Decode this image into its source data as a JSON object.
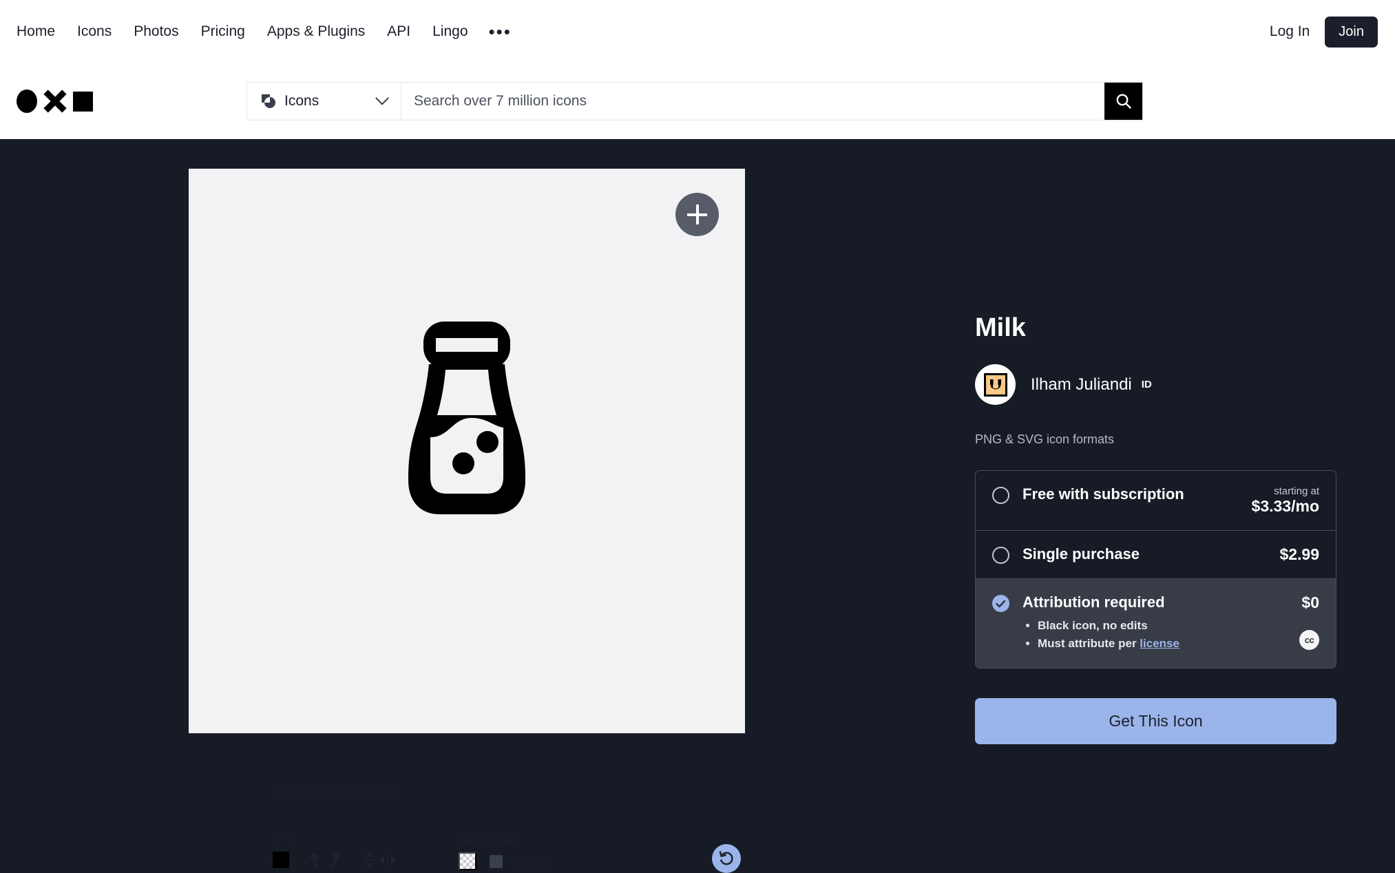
{
  "nav": {
    "links": [
      "Home",
      "Icons",
      "Photos",
      "Pricing",
      "Apps & Plugins",
      "API",
      "Lingo"
    ],
    "more": "•••",
    "login": "Log In",
    "join": "Join"
  },
  "search": {
    "type_label": "Icons",
    "placeholder": "Search over 7 million icons",
    "value": "",
    "search_icon": "search-icon"
  },
  "preview": {
    "add_icon": "plus-icon",
    "icon_name": "milk-bottle-icon",
    "customize_title": "Customize this icon",
    "icon_group_label": "Icon",
    "background_group_label": "Background",
    "background_square_label": "Square",
    "icon_color": "#000000",
    "background_square_color": "#3a3f4d",
    "tools": [
      "rotate-left-icon",
      "rotate-right-icon",
      "flip-vertical-icon",
      "flip-horizontal-icon"
    ],
    "reset_label": "reset-icon"
  },
  "detail": {
    "title": "Milk",
    "author": "Ilham Juliandi",
    "author_country": "ID",
    "formats": "PNG & SVG icon formats",
    "options": [
      {
        "label": "Free with subscription",
        "note": "starting at",
        "price": "$3.33/mo",
        "selected": false,
        "bullets": []
      },
      {
        "label": "Single purchase",
        "note": "",
        "price": "$2.99",
        "selected": false,
        "bullets": []
      },
      {
        "label": "Attribution required",
        "note": "",
        "price": "$0",
        "selected": true,
        "bullets": [
          "Black icon, no edits",
          "Must attribute per "
        ],
        "license_link": "license",
        "badge": "cc"
      }
    ],
    "cta": "Get This Icon"
  },
  "colors": {
    "page_bg": "#171b26",
    "card_bg": "#f2f2f4",
    "accent": "#9bb5ea",
    "option_selected_bg": "#383c47",
    "dark_ink": "#1b1f2b"
  }
}
